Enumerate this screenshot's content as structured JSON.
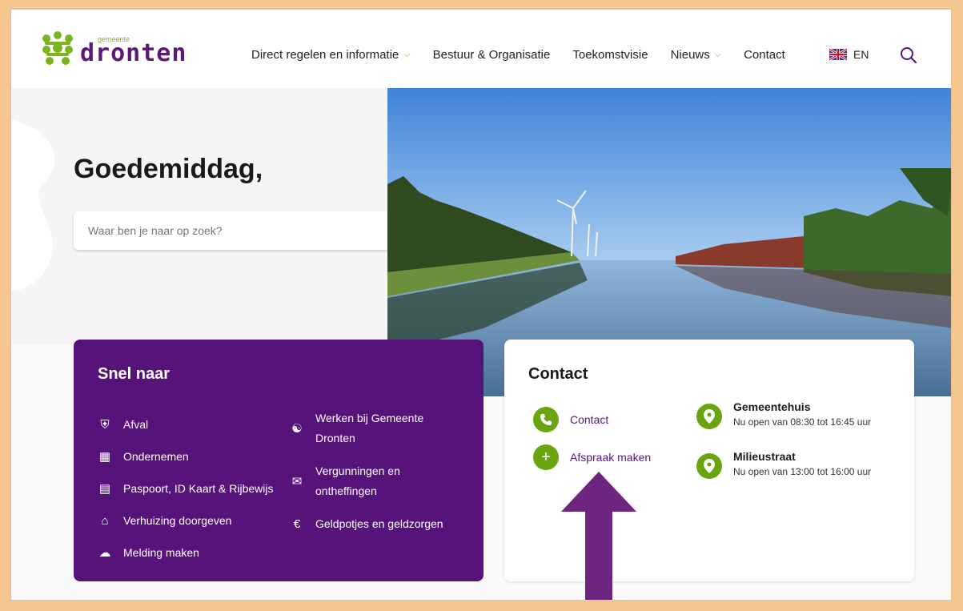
{
  "header": {
    "logo_small": "gemeente",
    "logo_main": "dronten",
    "nav": [
      {
        "label": "Direct regelen en informatie",
        "has_dropdown": true
      },
      {
        "label": "Bestuur & Organisatie",
        "has_dropdown": false
      },
      {
        "label": "Toekomstvisie",
        "has_dropdown": false
      },
      {
        "label": "Nieuws",
        "has_dropdown": true
      },
      {
        "label": "Contact",
        "has_dropdown": false
      }
    ],
    "language": "EN"
  },
  "hero": {
    "greeting": "Goedemiddag,",
    "search_placeholder": "Waar ben je naar op zoek?"
  },
  "snel_naar": {
    "title": "Snel naar",
    "col1": [
      {
        "label": "Afval",
        "icon": "truck-icon"
      },
      {
        "label": "Ondernemen",
        "icon": "factory-icon"
      },
      {
        "label": "Paspoort, ID Kaart & Rijbewijs",
        "icon": "id-card-icon"
      },
      {
        "label": "Verhuizing doorgeven",
        "icon": "home-icon"
      },
      {
        "label": "Melding maken",
        "icon": "megaphone-icon"
      }
    ],
    "col2": [
      {
        "label_line1": "Werken bij Gemeente",
        "label_line2": "Dronten",
        "icon": "worker-icon"
      },
      {
        "label_line1": "Vergunningen en",
        "label_line2": "ontheffingen",
        "icon": "envelope-icon"
      },
      {
        "label_line1": "Geldpotjes en geldzorgen",
        "label_line2": "",
        "icon": "euro-icon"
      }
    ]
  },
  "contact": {
    "title": "Contact",
    "links": [
      {
        "label": "Contact",
        "icon": "phone-icon"
      },
      {
        "label": "Afspraak maken",
        "icon": "plus-icon"
      }
    ],
    "locations": [
      {
        "name": "Gemeentehuis",
        "hours": "Nu open van 08:30 tot 16:45 uur"
      },
      {
        "name": "Milieustraat",
        "hours": "Nu open van 13:00 tot 16:00 uur"
      }
    ]
  },
  "colors": {
    "purple": "#56147a",
    "green": "#6aa50f",
    "frame": "#f6c88f"
  }
}
